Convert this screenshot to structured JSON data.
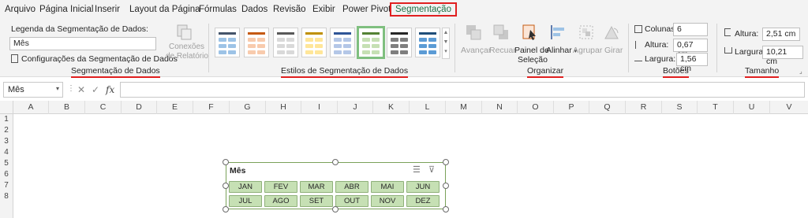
{
  "menu": {
    "tabs": [
      "Arquivo",
      "Página Inicial",
      "Inserir",
      "Layout da Página",
      "Fórmulas",
      "Dados",
      "Revisão",
      "Exibir",
      "Power Pivot",
      "Segmentação"
    ],
    "active": "Segmentação"
  },
  "ribbon": {
    "slicer_group": {
      "caption_label": "Legenda da Segmentação de Dados:",
      "caption_value": "Mês",
      "settings_label": "Configurações da Segmentação de Dados",
      "report_connections_line1": "Conexões",
      "report_connections_line2": "de Relatório",
      "group_label": "Segmentação de Dados"
    },
    "styles_group": {
      "group_label": "Estilos de Segmentação de Dados"
    },
    "arrange_group": {
      "bring_forward": "Avançar",
      "send_backward": "Recuar",
      "selection_pane_line1": "Painel de",
      "selection_pane_line2": "Seleção",
      "align": "Alinhar",
      "group": "Agrupar",
      "rotate": "Girar",
      "group_label": "Organizar"
    },
    "buttons_group": {
      "columns_label": "Colunas:",
      "columns_value": "6",
      "height_label": "Altura:",
      "height_value": "0,67 cm",
      "width_label": "Largura:",
      "width_value": "1,56 cm",
      "group_label": "Botões"
    },
    "size_group": {
      "height_label": "Altura:",
      "height_value": "2,51 cm",
      "width_label": "Largura:",
      "width_value": "10,21 cm",
      "group_label": "Tamanho"
    }
  },
  "formula_bar": {
    "name_box": "Mês",
    "fx": "fx"
  },
  "columns": [
    "A",
    "B",
    "C",
    "D",
    "E",
    "F",
    "G",
    "H",
    "I",
    "J",
    "K",
    "L",
    "M",
    "N",
    "O",
    "P",
    "Q",
    "R",
    "S",
    "T",
    "U",
    "V"
  ],
  "rows": [
    "1",
    "2",
    "3",
    "4",
    "5",
    "6",
    "7",
    "8"
  ],
  "slicer": {
    "title": "Mês",
    "buttons": [
      "JAN",
      "FEV",
      "MAR",
      "ABR",
      "MAI",
      "JUN",
      "JUL",
      "AGO",
      "SET",
      "OUT",
      "NOV",
      "DEZ"
    ]
  },
  "colors": {
    "accent_green": "#1e7145",
    "slicer_button": "#c6e0b4",
    "highlight_red": "#e02020"
  }
}
